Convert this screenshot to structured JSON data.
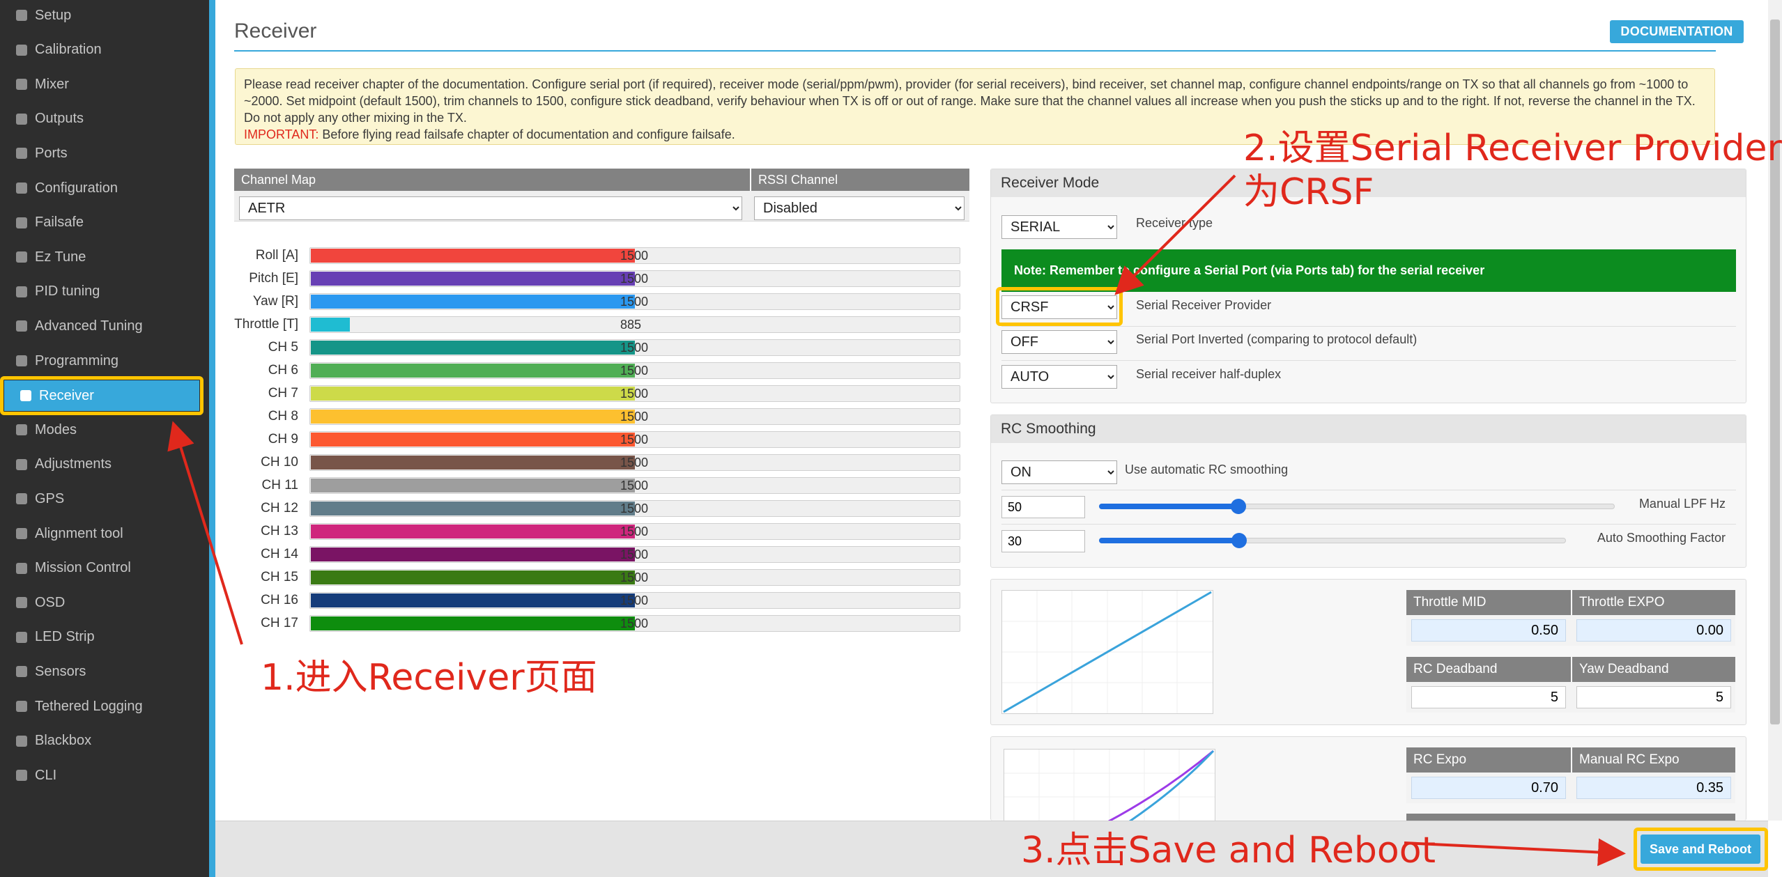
{
  "sidebar": {
    "items": [
      {
        "label": "Setup",
        "icon": "wrench-icon"
      },
      {
        "label": "Calibration",
        "icon": "crosshair-icon"
      },
      {
        "label": "Mixer",
        "icon": "mixer-icon"
      },
      {
        "label": "Outputs",
        "icon": "output-icon"
      },
      {
        "label": "Ports",
        "icon": "plug-icon"
      },
      {
        "label": "Configuration",
        "icon": "gear-icon"
      },
      {
        "label": "Failsafe",
        "icon": "parachute-icon"
      },
      {
        "label": "Ez Tune",
        "icon": "magic-wand-icon"
      },
      {
        "label": "PID tuning",
        "icon": "pid-icon"
      },
      {
        "label": "Advanced Tuning",
        "icon": "advanced-tuning-icon"
      },
      {
        "label": "Programming",
        "icon": "gear-icon"
      },
      {
        "label": "Receiver",
        "icon": "receiver-icon"
      },
      {
        "label": "Modes",
        "icon": "toggle-icon"
      },
      {
        "label": "Adjustments",
        "icon": "sliders-icon"
      },
      {
        "label": "GPS",
        "icon": "satellite-icon"
      },
      {
        "label": "Alignment tool",
        "icon": "compass-icon"
      },
      {
        "label": "Mission Control",
        "icon": "map-pin-icon"
      },
      {
        "label": "OSD",
        "icon": "osd-icon"
      },
      {
        "label": "LED Strip",
        "icon": "led-icon"
      },
      {
        "label": "Sensors",
        "icon": "sensor-icon"
      },
      {
        "label": "Tethered Logging",
        "icon": "log-icon"
      },
      {
        "label": "Blackbox",
        "icon": "blackbox-icon"
      },
      {
        "label": "CLI",
        "icon": "terminal-icon"
      }
    ],
    "active_index": 11
  },
  "page": {
    "title": "Receiver",
    "documentation_label": "DOCUMENTATION",
    "notice_text": "Please read receiver chapter of the documentation. Configure serial port (if required), receiver mode (serial/ppm/pwm), provider (for serial receivers), bind receiver, set channel map, configure channel endpoints/range on TX so that all channels go from ~1000 to ~2000. Set midpoint (default 1500), trim channels to 1500, configure stick deadband, verify behaviour when TX is off or out of range. Make sure that the channel values all increase when you push the sticks up and to the right. If not, reverse the channel in the TX. Do not apply any other mixing in the TX.",
    "notice_important_label": "IMPORTANT:",
    "notice_important_text": " Before flying read failsafe chapter of documentation and configure failsafe."
  },
  "channel_map": {
    "header": "Channel Map",
    "rssi_header": "RSSI Channel",
    "value": "AETR",
    "rssi_value": "Disabled"
  },
  "channels": [
    {
      "label": "Roll [A]",
      "value": 1500,
      "display": "1500",
      "color": "#f1453d"
    },
    {
      "label": "Pitch [E]",
      "value": 1500,
      "display": "1500",
      "color": "#673fb4"
    },
    {
      "label": "Yaw [R]",
      "value": 1500,
      "display": "1500",
      "color": "#2b98f0"
    },
    {
      "label": "Throttle [T]",
      "value": 885,
      "display": "885",
      "color": "#1fbcd2"
    },
    {
      "label": "CH 5",
      "value": 1500,
      "display": "1500",
      "color": "#159588"
    },
    {
      "label": "CH 6",
      "value": 1500,
      "display": "1500",
      "color": "#50ae55"
    },
    {
      "label": "CH 7",
      "value": 1500,
      "display": "1500",
      "color": "#cdda49"
    },
    {
      "label": "CH 8",
      "value": 1500,
      "display": "1500",
      "color": "#fdc02f"
    },
    {
      "label": "CH 9",
      "value": 1500,
      "display": "1500",
      "color": "#fc5830"
    },
    {
      "label": "CH 10",
      "value": 1500,
      "display": "1500",
      "color": "#785549"
    },
    {
      "label": "CH 11",
      "value": 1500,
      "display": "1500",
      "color": "#9e9e9e"
    },
    {
      "label": "CH 12",
      "value": 1500,
      "display": "1500",
      "color": "#617d8a"
    },
    {
      "label": "CH 13",
      "value": 1500,
      "display": "1500",
      "color": "#cf267d"
    },
    {
      "label": "CH 14",
      "value": 1500,
      "display": "1500",
      "color": "#7a1464"
    },
    {
      "label": "CH 15",
      "value": 1500,
      "display": "1500",
      "color": "#3a7a14"
    },
    {
      "label": "CH 16",
      "value": 1500,
      "display": "1500",
      "color": "#153c7a"
    },
    {
      "label": "CH 17",
      "value": 1500,
      "display": "1500",
      "color": "#0e8d0e"
    }
  ],
  "receiver_mode": {
    "header": "Receiver Mode",
    "type_value": "SERIAL",
    "type_label": "Receiver type",
    "note": "Note: Remember to configure a Serial Port (via Ports tab) for the serial receiver",
    "provider_value": "CRSF",
    "provider_label": "Serial Receiver Provider",
    "inverted_value": "OFF",
    "inverted_label": "Serial Port Inverted (comparing to protocol default)",
    "half_duplex_value": "AUTO",
    "half_duplex_label": "Serial receiver half-duplex"
  },
  "rc_smoothing": {
    "header": "RC Smoothing",
    "auto_value": "ON",
    "auto_label": "Use automatic RC smoothing",
    "lpf_value": "50",
    "lpf_label": "Manual LPF Hz",
    "lpf_level": 0.27,
    "factor_value": "30",
    "factor_label": "Auto Smoothing Factor",
    "factor_level": 0.3
  },
  "throttle_table": {
    "mid_header": "Throttle MID",
    "expo_header": "Throttle EXPO",
    "mid_value": "0.50",
    "expo_value": "0.00",
    "rc_deadband_header": "RC Deadband",
    "yaw_deadband_header": "Yaw Deadband",
    "rc_deadband_value": "5",
    "yaw_deadband_value": "5"
  },
  "rate_table": {
    "rc_expo_header": "RC Expo",
    "manual_expo_header": "Manual RC Expo",
    "rc_expo_value": "0.70",
    "manual_expo_value": "0.35"
  },
  "bottom_bar": {
    "save_label": "Save and Reboot"
  },
  "annotations": {
    "step1": "1.进入Receiver页面",
    "step2_line1": "2.设置Serial Receiver Provider",
    "step2_line2": "为CRSF",
    "step3": "3.点击Save and Reboot"
  },
  "colors": {
    "accent": "#37a8db",
    "highlight": "#ffc400",
    "annotation": "#e0281c",
    "note_green": "#0c8c1f"
  }
}
